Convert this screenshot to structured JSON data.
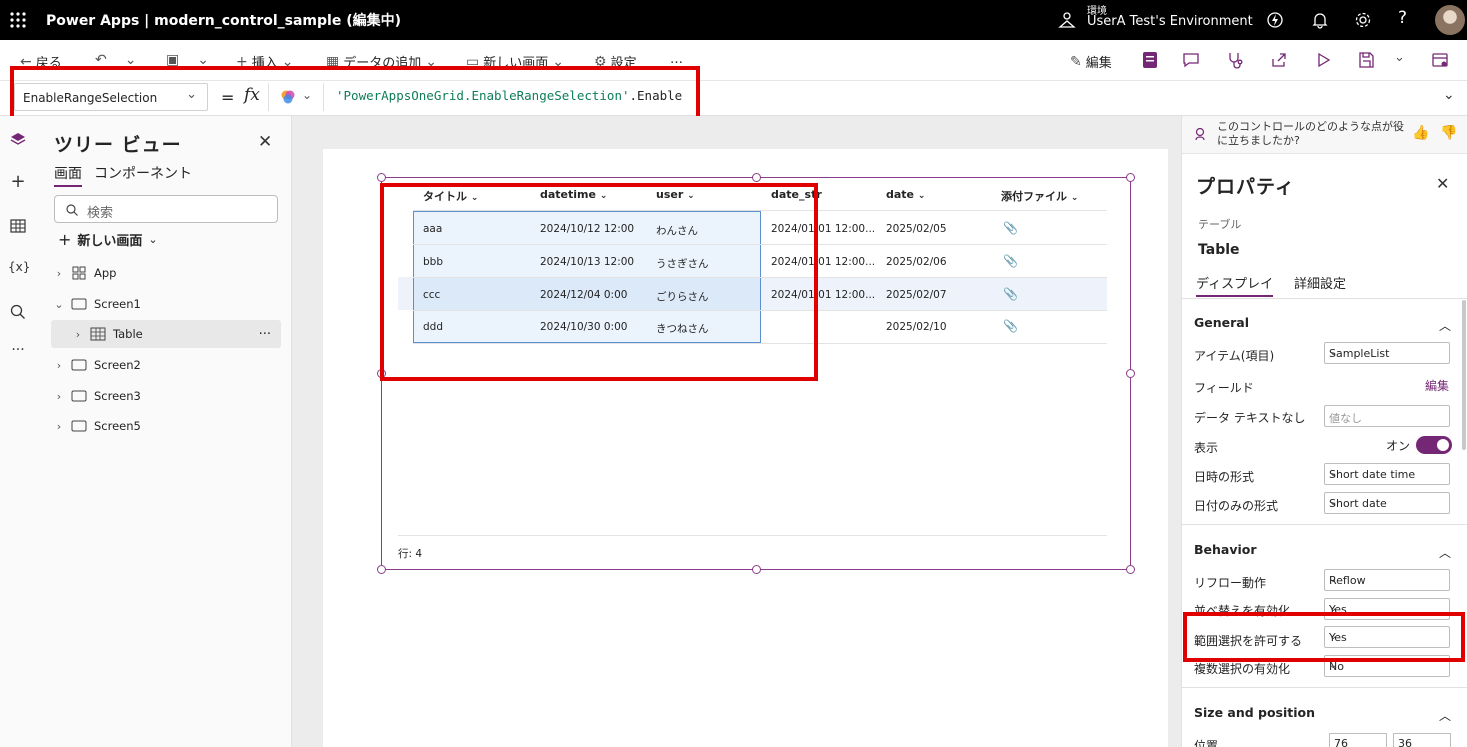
{
  "topbar": {
    "title": "Power Apps  |  modern_control_sample (編集中)",
    "env_label": "環境",
    "env_name": "UserA Test's Environment"
  },
  "commandbar": {
    "back": "戻る",
    "insert": "挿入",
    "add_data": "データの追加",
    "new_screen": "新しい画面",
    "settings": "設定",
    "more": "…",
    "edit": "編集"
  },
  "formula": {
    "property": "EnableRangeSelection",
    "equals": "=",
    "fx": "fx",
    "string_part": "'PowerAppsOneGrid.EnableRangeSelection'",
    "rest": ".Enable"
  },
  "tree": {
    "title": "ツリー ビュー",
    "tab_screens": "画面",
    "tab_components": "コンポーネント",
    "search_placeholder": "検索",
    "new_screen": "新しい画面",
    "nodes": [
      {
        "label": "App"
      },
      {
        "label": "Screen1"
      },
      {
        "label": "Table"
      },
      {
        "label": "Screen2"
      },
      {
        "label": "Screen3"
      },
      {
        "label": "Screen5"
      }
    ],
    "node_more": "···"
  },
  "grid": {
    "headers": [
      "タイトル",
      "datetime",
      "user",
      "date_str",
      "date",
      "添付ファイル"
    ],
    "rows": [
      [
        "aaa",
        "2024/10/12 12:00",
        "わんさん",
        "2024/01/01 12:00...",
        "2025/02/05"
      ],
      [
        "bbb",
        "2024/10/13 12:00",
        "うさぎさん",
        "2024/01/01 12:00...",
        "2025/02/06"
      ],
      [
        "ccc",
        "2024/12/04 0:00",
        "ごりらさん",
        "2024/01/01 12:00...",
        "2025/02/07"
      ],
      [
        "ddd",
        "2024/10/30 0:00",
        "きつねさん",
        "",
        "2025/02/10"
      ]
    ],
    "row_count": "行: 4"
  },
  "feedback": {
    "line1": "このコントロールのどのような点が役",
    "line2": "に立ちましたか?"
  },
  "properties": {
    "title": "プロパティ",
    "type_label": "テーブル",
    "control_name": "Table",
    "tab_display": "ディスプレイ",
    "tab_advanced": "詳細設定",
    "general": "General",
    "items_label": "アイテム(項目)",
    "items_value": "SampleList",
    "fields_label": "フィールド",
    "fields_edit": "編集",
    "no_data_label": "データ テキストなし",
    "no_data_placeholder": "値なし",
    "visible_label": "表示",
    "visible_value": "オン",
    "datetime_label": "日時の形式",
    "datetime_value": "Short date time",
    "dateonly_label": "日付のみの形式",
    "dateonly_value": "Short date",
    "behavior": "Behavior",
    "reflow_label": "リフロー動作",
    "reflow_value": "Reflow",
    "sort_label": "並べ替えを有効化",
    "sort_value": "Yes",
    "range_label": "範囲選択を許可する",
    "range_value": "Yes",
    "multi_label": "複数選択の有効化",
    "multi_value": "No",
    "size_pos": "Size and position",
    "position_label": "位置",
    "pos_x": "76",
    "pos_y": "36"
  },
  "colors": {
    "accent": "#742774",
    "highlight": "#e00000",
    "selection": "#5b8fd1"
  }
}
